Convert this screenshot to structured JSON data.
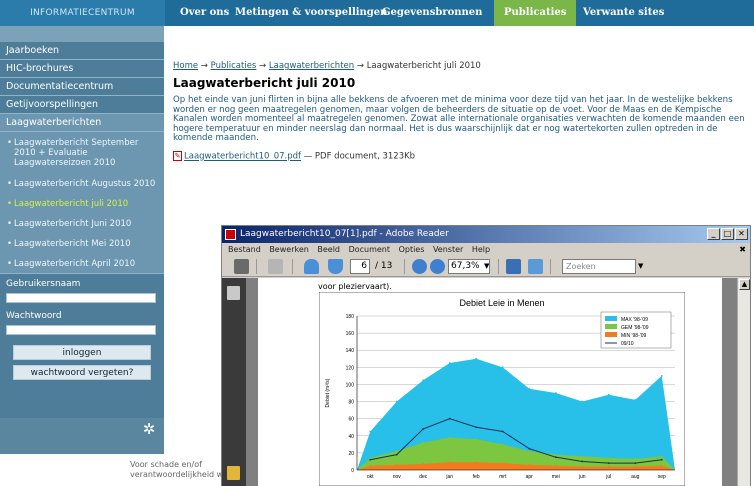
{
  "topnav": {
    "brand": "INFORMATIECENTRUM",
    "items": [
      "Over ons",
      "Metingen & voorspellingen",
      "Gegevensbronnen",
      "Publicaties",
      "Verwante sites"
    ],
    "active": "Publicaties"
  },
  "sidebar": {
    "links": [
      "Jaarboeken",
      "HIC-brochures",
      "Documentatiecentrum",
      "Getijvoorspellingen",
      "Laagwaterberichten"
    ],
    "subitems": [
      "Laagwaterbericht September 2010 + Evaluatie Laagwaterseizoen 2010",
      "Laagwaterbericht Augustus 2010",
      "Laagwaterbericht juli 2010",
      "Laagwaterbericht Juni 2010",
      "Laagwaterbericht Mei 2010",
      "Laagwaterbericht April 2010"
    ],
    "username_label": "Gebruikersnaam",
    "password_label": "Wachtwoord",
    "login_button": "inloggen",
    "forgot_button": "wachtwoord vergeten?"
  },
  "main": {
    "breadcrumb": [
      "Home",
      "Publicaties",
      "Laagwaterberichten",
      "Laagwaterbericht juli 2010"
    ],
    "title": "Laagwaterbericht juli 2010",
    "intro": "Op het einde van juni flirten in bijna alle bekkens de afvoeren met de minima voor deze tijd van het jaar. In de westelijke bekkens worden er nog geen maatregelen genomen, maar volgen de beheerders de situatie op de voet. Voor de Maas en de Kempische Kanalen worden momenteel al maatregelen genomen. Zowat alle internationale organisaties verwachten de komende maanden een hogere temperatuur en minder neerslag dan normaal. Het is dus waarschijnlijk dat er nog watertekorten zullen optreden in de komende maanden.",
    "attachment_name": "Laagwaterbericht10_07.pdf",
    "attachment_meta": "— PDF document, 3123Kb",
    "footer_line1": "Voor schade en/of",
    "footer_line2": "verantwoordelijkheid w"
  },
  "reader": {
    "title": "Laagwaterbericht10_07[1].pdf - Adobe Reader",
    "menu": [
      "Bestand",
      "Bewerken",
      "Beeld",
      "Document",
      "Opties",
      "Venster",
      "Help"
    ],
    "page_current": "6",
    "page_total": "/ 13",
    "zoom": "67,3%",
    "search_placeholder": "Zoeken",
    "page_note": "voor pleziervaart)."
  },
  "chart_data": {
    "type": "area",
    "title": "Debiet Leie in Menen",
    "ylabel": "Debiet (m³/s)",
    "xlabel": "",
    "categories": [
      "okt",
      "nov",
      "dec",
      "jan",
      "feb",
      "mrt",
      "apr",
      "mei",
      "jun",
      "jul",
      "aug",
      "sep"
    ],
    "ylim": [
      0,
      180
    ],
    "yticks": [
      0,
      20,
      40,
      60,
      80,
      100,
      120,
      140,
      160,
      180
    ],
    "legend_position": "top-right",
    "series": [
      {
        "name": "MAX '98-'09",
        "color": "#28c0e8",
        "values": [
          45,
          80,
          105,
          125,
          130,
          120,
          95,
          90,
          80,
          88,
          82,
          110
        ]
      },
      {
        "name": "GEM '98-'09",
        "color": "#7cc640",
        "values": [
          14,
          22,
          32,
          38,
          36,
          30,
          22,
          18,
          16,
          14,
          13,
          16
        ]
      },
      {
        "name": "MIN '98-'09",
        "color": "#f47a20",
        "values": [
          5,
          6,
          7,
          9,
          9,
          8,
          6,
          5,
          4,
          4,
          4,
          5
        ]
      },
      {
        "name": "09/10",
        "color": "#1b2f55",
        "values": [
          12,
          18,
          48,
          60,
          50,
          45,
          25,
          15,
          10,
          8,
          8,
          12
        ]
      }
    ]
  }
}
